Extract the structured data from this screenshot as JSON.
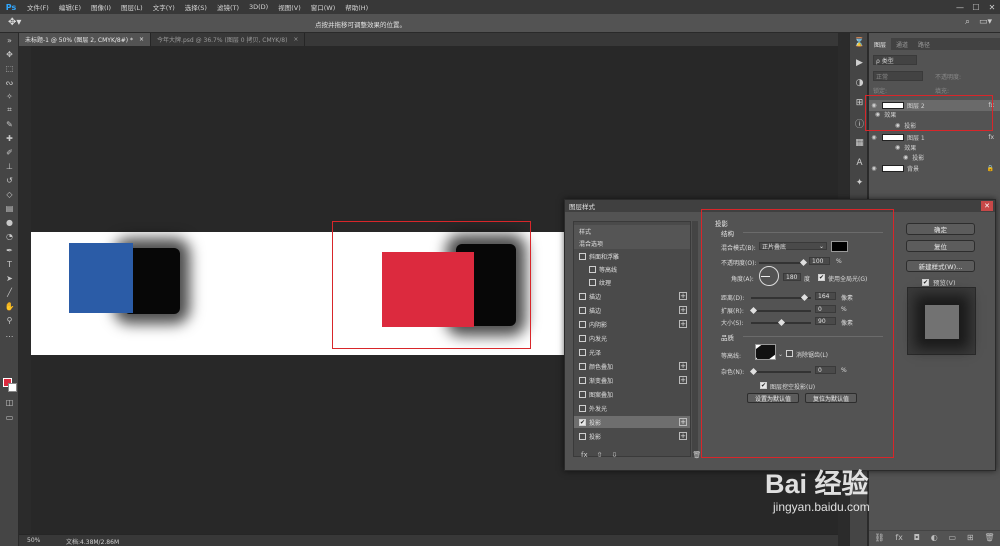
{
  "app": {
    "logo": "Ps",
    "menus": [
      "文件(F)",
      "编辑(E)",
      "图像(I)",
      "图层(L)",
      "文字(Y)",
      "选择(S)",
      "滤镜(T)",
      "3D(D)",
      "视图(V)",
      "窗口(W)",
      "帮助(H)"
    ],
    "window_controls": [
      "—",
      "☐",
      "✕"
    ]
  },
  "options_bar": {
    "hint": "点按并拖移可调整效果的位置。"
  },
  "tabs": [
    {
      "label": "未标题-1 @ 50% (图层 2, CMYK/8#) *",
      "active": true
    },
    {
      "label": "今年大牌.psd @ 36.7% (图层 0 拷贝, CMYK/8)",
      "active": false
    }
  ],
  "status_bar": {
    "zoom": "50%",
    "doc": "文档:4.38M/2.86M"
  },
  "colors": {
    "foreground": "#dc2a3e",
    "background": "#ffffff",
    "blue_shape": "#2b5ca7",
    "red_shape": "#dc2a3e",
    "highlight": "#d8262a"
  },
  "layers_panel": {
    "tabs": [
      "图层",
      "通道",
      "路径"
    ],
    "kind_filter": "ρ 类型",
    "blend_mode": "正常",
    "opacity_label": "不透明度:",
    "lock_label": "锁定:",
    "fill_label": "填充:",
    "layers": [
      {
        "name": "图层 2",
        "selected": true,
        "fx": "fx",
        "effects_label": "效果",
        "effect": "投影"
      },
      {
        "name": "图层 1",
        "selected": false,
        "fx": "fx",
        "effects_label": "效果",
        "effect": "投影"
      },
      {
        "name": "背景",
        "selected": false
      }
    ]
  },
  "dialog": {
    "title": "图层样式",
    "close": "✕",
    "style_list": [
      {
        "label": "样式",
        "type": "header"
      },
      {
        "label": "混合选项",
        "type": "header"
      },
      {
        "label": "斜面和浮雕",
        "checkbox": true,
        "checked": false
      },
      {
        "label": "等高线",
        "checkbox": true,
        "checked": false,
        "indent": true
      },
      {
        "label": "纹理",
        "checkbox": true,
        "checked": false,
        "indent": true
      },
      {
        "label": "描边",
        "checkbox": true,
        "checked": false,
        "plus": true
      },
      {
        "label": "描边",
        "checkbox": true,
        "checked": false,
        "plus": true
      },
      {
        "label": "内阴影",
        "checkbox": true,
        "checked": false,
        "plus": true
      },
      {
        "label": "内发光",
        "checkbox": true,
        "checked": false
      },
      {
        "label": "光泽",
        "checkbox": true,
        "checked": false
      },
      {
        "label": "颜色叠加",
        "checkbox": true,
        "checked": false,
        "plus": true
      },
      {
        "label": "渐变叠加",
        "checkbox": true,
        "checked": false,
        "plus": true
      },
      {
        "label": "图案叠加",
        "checkbox": true,
        "checked": false
      },
      {
        "label": "外发光",
        "checkbox": true,
        "checked": false
      },
      {
        "label": "投影",
        "checkbox": true,
        "checked": true,
        "plus": true,
        "active": true
      },
      {
        "label": "投影",
        "checkbox": true,
        "checked": false,
        "plus": true
      }
    ],
    "list_bottom": [
      "fx",
      "⇧",
      "⇩",
      "🗑"
    ],
    "options": {
      "section_title": "投影",
      "structure_title": "结构",
      "blend_mode_label": "混合模式(B):",
      "blend_mode_value": "正片叠底",
      "opacity_label": "不透明度(O):",
      "opacity_value": "100",
      "opacity_unit": "%",
      "angle_label": "角度(A):",
      "angle_value": "180",
      "angle_unit": "度",
      "global_light_label": "使用全局光(G)",
      "distance_label": "距离(D):",
      "distance_value": "164",
      "distance_unit": "像素",
      "spread_label": "扩展(R):",
      "spread_value": "0",
      "spread_unit": "%",
      "size_label": "大小(S):",
      "size_value": "90",
      "size_unit": "像素",
      "quality_title": "品质",
      "contour_label": "等高线:",
      "antialias_label": "消除锯齿(L)",
      "noise_label": "杂色(N):",
      "noise_value": "0",
      "noise_unit": "%",
      "knockout_label": "图层挖空投影(U)",
      "set_default": "设置为默认值",
      "reset_default": "复位为默认值"
    },
    "buttons": {
      "ok": "确定",
      "reset": "复位",
      "new_style": "新建样式(W)...",
      "preview": "预览(V)"
    }
  },
  "watermark": {
    "brand": "Bai 经验",
    "url": "jingyan.baidu.com"
  }
}
